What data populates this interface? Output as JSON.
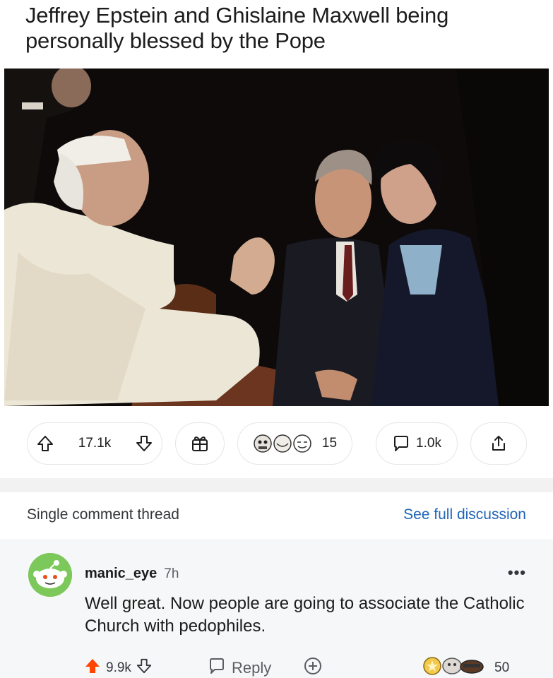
{
  "post": {
    "title": "Jeffrey Epstein and Ghislaine Maxwell being personally blessed by the Pope"
  },
  "action_bar": {
    "upvotes": "17.1k",
    "reactions_count": "15",
    "comments_count": "1.0k"
  },
  "thread": {
    "single_label": "Single comment thread",
    "see_full_label": "See full discussion"
  },
  "comment": {
    "username": "manic_eye",
    "time": "7h",
    "more": "•••",
    "body": "Well great. Now people are going to associate the Catholic Church with pedophiles.",
    "upvotes": "9.9k",
    "reply_label": "Reply",
    "awards_count": "50"
  },
  "colors": {
    "link_blue": "#1f64b8",
    "upvote_orange": "#ff4500",
    "avatar_green": "#7dc85a"
  },
  "icons": [
    "upvote-arrow-icon",
    "downvote-arrow-icon",
    "gift-icon",
    "reaction-emoji-icon",
    "comment-bubble-icon",
    "share-icon",
    "add-icon",
    "award-icon"
  ]
}
